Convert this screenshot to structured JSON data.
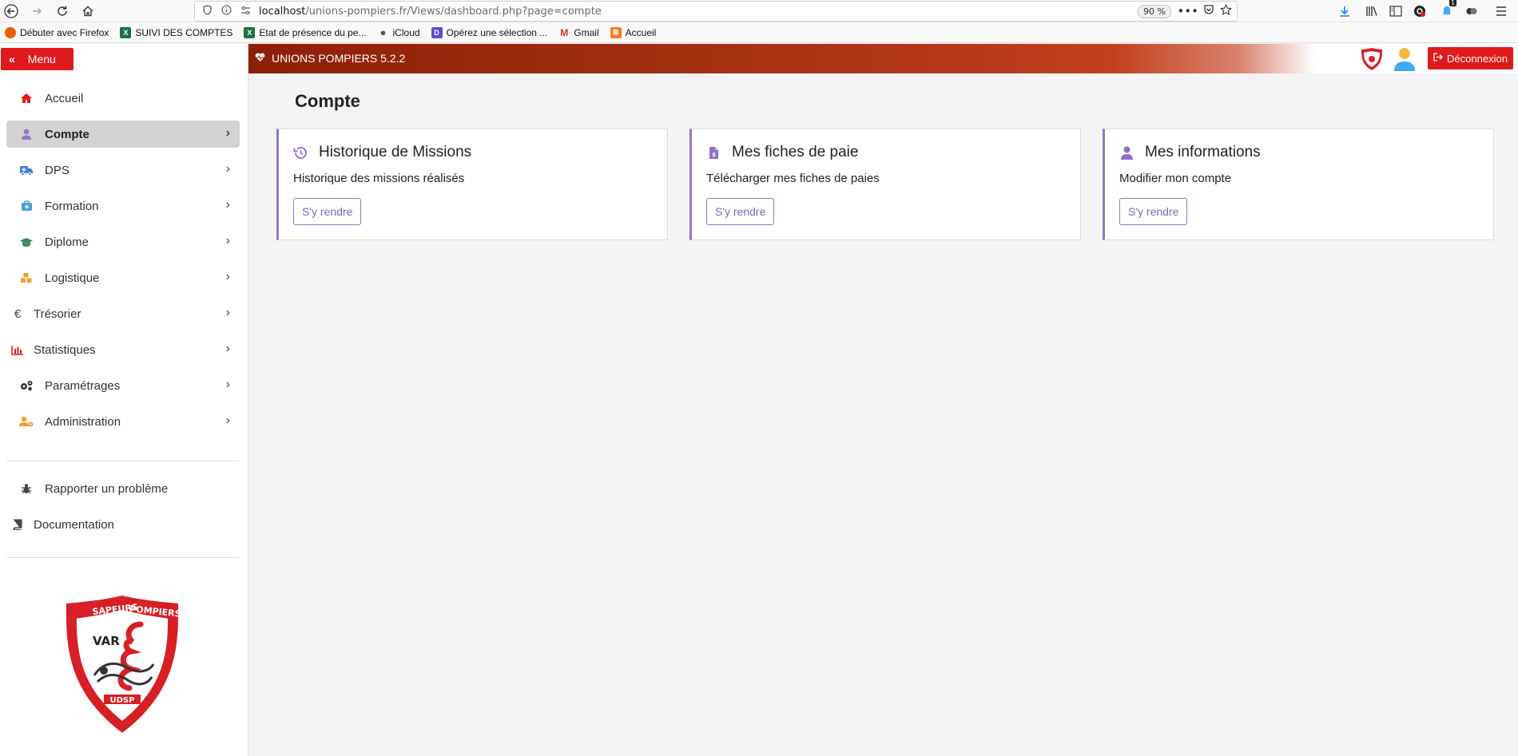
{
  "browser": {
    "url_host": "localhost",
    "url_path": "/unions-pompiers.fr/Views/dashboard.php?page=compte",
    "zoom": "90 %",
    "notification_count": "1",
    "bookmarks": [
      {
        "label": "Débuter avec Firefox",
        "icon": "firefox-icon",
        "color": "#e66000"
      },
      {
        "label": "SUIVI DES COMPTES",
        "icon": "excel-icon",
        "color": "#1d6f42"
      },
      {
        "label": "Etat de présence du pe...",
        "icon": "excel-icon",
        "color": "#1d6f42"
      },
      {
        "label": "iCloud",
        "icon": "apple-icon",
        "color": "#555555"
      },
      {
        "label": "Opérez une sélection ...",
        "icon": "bookmark-icon",
        "color": "#5b4fcf"
      },
      {
        "label": "Gmail",
        "icon": "gmail-icon",
        "color": "#d93025"
      },
      {
        "label": "Accueil",
        "icon": "xampp-icon",
        "color": "#fb7a24"
      }
    ]
  },
  "sidebar": {
    "menu_label": "Menu",
    "items": [
      {
        "label": "Accueil",
        "icon": "home-icon",
        "color": "#e0191c",
        "chevron": false,
        "active": false
      },
      {
        "label": "Compte",
        "icon": "user-icon",
        "color": "#9575cd",
        "chevron": true,
        "active": true
      },
      {
        "label": "DPS",
        "icon": "ambulance-icon",
        "color": "#3b7ddd",
        "chevron": true,
        "active": false
      },
      {
        "label": "Formation",
        "icon": "medkit-icon",
        "color": "#4a9fd4",
        "chevron": true,
        "active": false
      },
      {
        "label": "Diplome",
        "icon": "graduation-cap-icon",
        "color": "#3c8a54",
        "chevron": true,
        "active": false
      },
      {
        "label": "Logistique",
        "icon": "boxes-icon",
        "color": "#f0a030",
        "chevron": true,
        "active": false
      },
      {
        "label": "Trésorier",
        "icon": "euro-icon",
        "color": "#444444",
        "chevron": true,
        "active": false
      },
      {
        "label": "Statistiques",
        "icon": "bar-chart-icon",
        "color": "#e0191c",
        "chevron": true,
        "active": false
      },
      {
        "label": "Paramétrages",
        "icon": "cogs-icon",
        "color": "#333333",
        "chevron": true,
        "active": false
      },
      {
        "label": "Administration",
        "icon": "users-cog-icon",
        "color": "#f0a030",
        "chevron": true,
        "active": false
      }
    ],
    "secondary_items": [
      {
        "label": "Rapporter un problème",
        "icon": "bug-icon",
        "color": "#444444"
      },
      {
        "label": "Documentation",
        "icon": "book-icon",
        "color": "#444444"
      }
    ],
    "logo": {
      "top_text": "SAPEURS POMPIERS",
      "middle_text": "VAR",
      "bottom_text": "UDSP"
    }
  },
  "header": {
    "app_title": "UNIONS POMPIERS 5.2.2",
    "logout_label": "Déconnexion"
  },
  "main": {
    "page_title": "Compte",
    "cards": [
      {
        "title": "Historique de Missions",
        "description": "Historique des missions réalisés",
        "button": "S'y rendre",
        "icon": "history-icon"
      },
      {
        "title": "Mes fiches de paie",
        "description": "Télécharger mes fiches de paies",
        "button": "S'y rendre",
        "icon": "file-invoice-icon"
      },
      {
        "title": "Mes informations",
        "description": "Modifier mon compte",
        "button": "S'y rendre",
        "icon": "user-icon"
      }
    ]
  },
  "colors": {
    "accent_red": "#e0191c",
    "card_accent": "#9575cd"
  }
}
